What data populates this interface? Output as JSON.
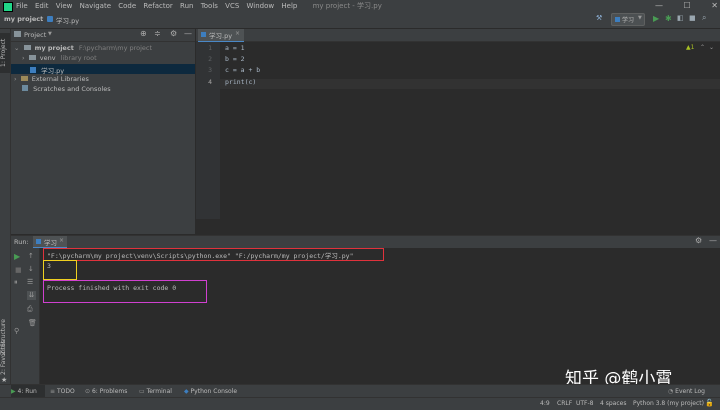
{
  "menu": {
    "items": [
      "File",
      "Edit",
      "View",
      "Navigate",
      "Code",
      "Refactor",
      "Run",
      "Tools",
      "VCS",
      "Window",
      "Help"
    ],
    "window_title": "my project - 学习.py"
  },
  "nav": {
    "project": "my project",
    "file": "学习.py",
    "run_config": "学习"
  },
  "side_tabs": {
    "project": "1: Project",
    "structure": "Z: Structure",
    "favorites": "2: Favorites"
  },
  "project_panel": {
    "title": "Project",
    "tree": [
      {
        "label": "my project",
        "hint": "F:\\pycharm\\my project"
      },
      {
        "label": "venv",
        "hint": "library root"
      },
      {
        "label": "学习.py",
        "hint": ""
      },
      {
        "label": "External Libraries",
        "hint": ""
      },
      {
        "label": "Scratches and Consoles",
        "hint": ""
      }
    ]
  },
  "editor": {
    "tab": "学习.py",
    "line_numbers": [
      "1",
      "2",
      "3",
      "4"
    ],
    "lines": [
      "a = 1",
      "b = 2",
      "c = a + b",
      "print(c)"
    ]
  },
  "run_panel": {
    "label": "Run:",
    "tab": "学习",
    "command": "\"F:\\pycharm\\my project\\venv\\Scripts\\python.exe\" \"F:/pycharm/my project/学习.py\"",
    "output": "3",
    "finished": "Process finished with exit code 0"
  },
  "bottom_tabs": [
    "4: Run",
    "TODO",
    "6: Problems",
    "Terminal",
    "Python Console"
  ],
  "status": {
    "position": "4:9",
    "line_sep": "CRLF",
    "encoding": "UTF-8",
    "indent": "4 spaces",
    "interpreter": "Python 3.8 (my project)",
    "event_log": "Event Log"
  },
  "watermark": "知乎 @鹤小霄",
  "colors": {
    "highlight_red": "#e0323c",
    "highlight_yellow": "#f0d020",
    "highlight_magenta": "#d040d0",
    "run_green": "#499c54"
  }
}
